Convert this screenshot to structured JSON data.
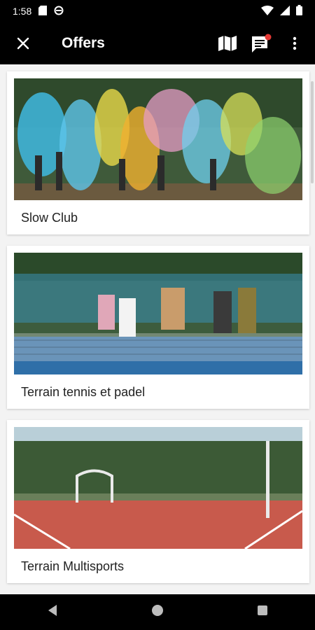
{
  "status": {
    "time": "1:58"
  },
  "header": {
    "title": "Offers"
  },
  "icons": {
    "close": "close-icon",
    "map": "map-icon",
    "chat": "chat-icon",
    "more": "more-vert-icon"
  },
  "offers": [
    {
      "label": "Slow Club"
    },
    {
      "label": "Terrain tennis et padel"
    },
    {
      "label": "Terrain Multisports"
    }
  ],
  "colors": {
    "accent_badge": "#e53935",
    "background": "#f3f3f3"
  }
}
